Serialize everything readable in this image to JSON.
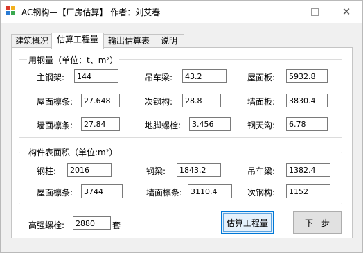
{
  "window": {
    "title": "AC钢构—【厂房估算】 作者：刘艾春",
    "minimize": "—",
    "maximize": "□",
    "close": "✕"
  },
  "tabs": [
    {
      "label": "建筑概况",
      "active": false
    },
    {
      "label": "估算工程量",
      "active": true
    },
    {
      "label": "输出估算表",
      "active": false
    },
    {
      "label": "说明",
      "active": false
    }
  ],
  "steel_group": {
    "title": "用钢量（单位：t、m²）",
    "fields": [
      {
        "label": "主钢架:",
        "value": "144"
      },
      {
        "label": "吊车梁:",
        "value": "43.2"
      },
      {
        "label": "屋面板:",
        "value": "5932.8"
      },
      {
        "label": "屋面檩条:",
        "value": "27.648"
      },
      {
        "label": "次钢构:",
        "value": "28.8"
      },
      {
        "label": "墙面板:",
        "value": "3830.4"
      },
      {
        "label": "墙面檩条:",
        "value": "27.84"
      },
      {
        "label": "地脚螺栓:",
        "value": "3.456"
      },
      {
        "label": "钢天沟:",
        "value": "6.78"
      }
    ]
  },
  "area_group": {
    "title": "构件表面积（单位:m²）",
    "fields": [
      {
        "label": "钢柱:",
        "value": "2016"
      },
      {
        "label": "钢梁:",
        "value": "1843.2"
      },
      {
        "label": "吊车梁:",
        "value": "1382.4"
      },
      {
        "label": "屋面檩条:",
        "value": "3744"
      },
      {
        "label": "墙面檩条:",
        "value": "3110.4"
      },
      {
        "label": "次钢构:",
        "value": "1152"
      }
    ]
  },
  "bolt": {
    "label": "高强螺栓:",
    "value": "2880",
    "unit": "套"
  },
  "buttons": {
    "estimate": "估算工程量",
    "next": "下一步"
  }
}
